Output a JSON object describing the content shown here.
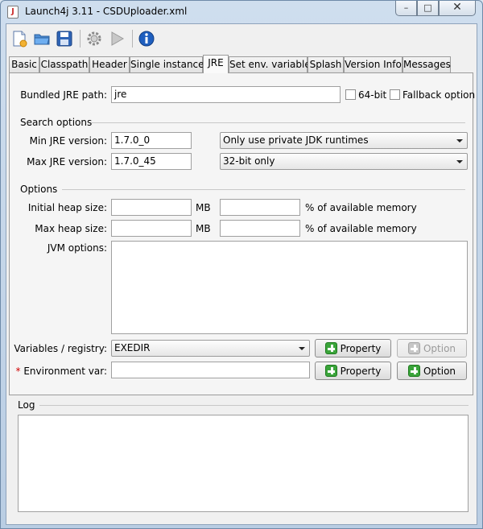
{
  "window": {
    "title": "Launch4j 3.11 - CSDUploader.xml",
    "app_icon_glyph": "J"
  },
  "toolbar": {
    "icons": [
      "new-document-icon",
      "open-folder-icon",
      "save-icon",
      "settings-gear-icon",
      "run-play-icon",
      "info-icon"
    ]
  },
  "tabs": [
    {
      "label": "Basic"
    },
    {
      "label": "Classpath"
    },
    {
      "label": "Header"
    },
    {
      "label": "Single instance"
    },
    {
      "label": "JRE",
      "active": true
    },
    {
      "label": "Set env. variables"
    },
    {
      "label": "Splash"
    },
    {
      "label": "Version Info"
    },
    {
      "label": "Messages"
    }
  ],
  "jre": {
    "bundled_label": "Bundled JRE path:",
    "bundled_value": "jre",
    "bit64_label": "64-bit",
    "fallback_label": "Fallback option",
    "search_options_heading": "Search options",
    "min_label": "Min JRE version:",
    "min_value": "1.7.0_0",
    "min_select": "Only use private JDK runtimes",
    "max_label": "Max JRE version:",
    "max_value": "1.7.0_45",
    "max_select": "32-bit only",
    "options_heading": "Options",
    "initial_heap_label": "Initial heap size:",
    "initial_heap_unit": "MB",
    "initial_heap_pct": "% of available memory",
    "max_heap_label": "Max heap size:",
    "max_heap_unit": "MB",
    "max_heap_pct": "% of available memory",
    "jvm_options_label": "JVM options:",
    "variables_label": "Variables / registry:",
    "variables_select": "EXEDIR",
    "property_button": "Property",
    "option_button": "Option",
    "env_required_mark": "*",
    "env_label": "Environment var:",
    "env_property_button": "Property",
    "env_option_button": "Option"
  },
  "log": {
    "heading": "Log"
  },
  "colors": {
    "plus_green": "#3aa43a",
    "required_red": "#d00000"
  }
}
